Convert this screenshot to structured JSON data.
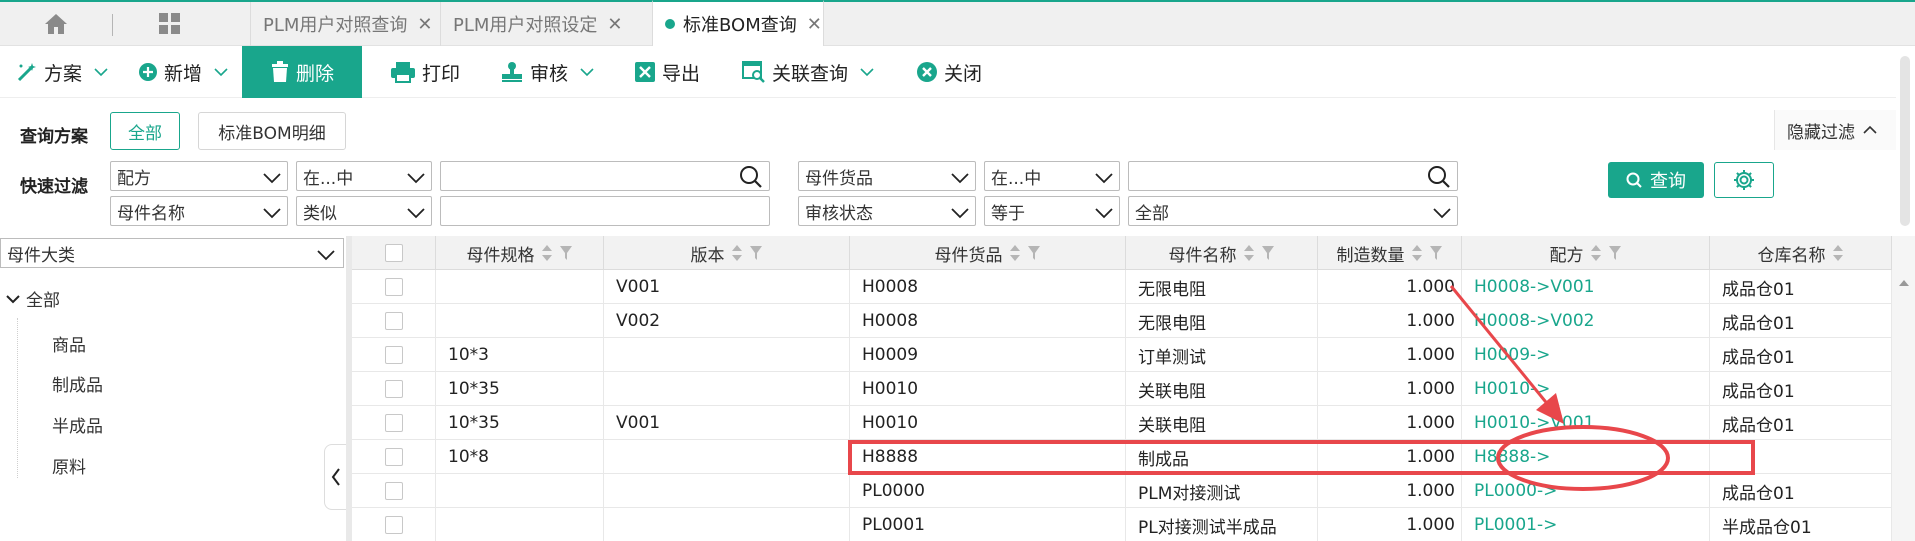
{
  "tabs": [
    {
      "label": "PLM用户对照查询"
    },
    {
      "label": "PLM用户对照设定"
    },
    {
      "label": "标准BOM查询"
    }
  ],
  "toolbar": {
    "scheme": "方案",
    "add": "新增",
    "delete": "删除",
    "print": "打印",
    "audit": "审核",
    "export": "导出",
    "related_query": "关联查询",
    "close": "关闭"
  },
  "filter": {
    "scheme_label": "查询方案",
    "scheme_all": "全部",
    "scheme_detail": "标准BOM明细",
    "hide_filter": "隐藏过滤",
    "quick_label": "快速过滤",
    "row1": {
      "field1": "配方",
      "op1": "在...中",
      "value1": "",
      "field2": "母件货品",
      "op2": "在...中",
      "value2": ""
    },
    "row2": {
      "field1": "母件名称",
      "op1": "类似",
      "value1": "",
      "field2": "审核状态",
      "op2": "等于",
      "value2": "全部"
    },
    "query_button": "查询"
  },
  "tree": {
    "category_select": "母件大类",
    "root": "全部",
    "items": [
      "商品",
      "制成品",
      "半成品",
      "原料"
    ]
  },
  "grid": {
    "columns": [
      "母件规格",
      "版本",
      "母件货品",
      "母件名称",
      "制造数量",
      "配方",
      "仓库名称"
    ],
    "rows": [
      {
        "spec": "",
        "version": "V001",
        "code": "H0008",
        "name": "无限电阻",
        "qty": "1.000",
        "formula": "H0008->V001",
        "warehouse": "成品仓01"
      },
      {
        "spec": "",
        "version": "V002",
        "code": "H0008",
        "name": "无限电阻",
        "qty": "1.000",
        "formula": "H0008->V002",
        "warehouse": "成品仓01"
      },
      {
        "spec": "10*3",
        "version": "",
        "code": "H0009",
        "name": "订单测试",
        "qty": "1.000",
        "formula": "H0009->",
        "warehouse": "成品仓01"
      },
      {
        "spec": "10*35",
        "version": "",
        "code": "H0010",
        "name": "关联电阻",
        "qty": "1.000",
        "formula": "H0010->",
        "warehouse": "成品仓01"
      },
      {
        "spec": "10*35",
        "version": "V001",
        "code": "H0010",
        "name": "关联电阻",
        "qty": "1.000",
        "formula": "H0010->V001",
        "warehouse": "成品仓01"
      },
      {
        "spec": "10*8",
        "version": "",
        "code": "H8888",
        "name": "制成品",
        "qty": "1.000",
        "formula": "H8888->",
        "warehouse": ""
      },
      {
        "spec": "",
        "version": "",
        "code": "PL0000",
        "name": "PLM对接测试",
        "qty": "1.000",
        "formula": "PL0000->",
        "warehouse": "成品仓01"
      },
      {
        "spec": "",
        "version": "",
        "code": "PL0001",
        "name": "PL对接测试半成品",
        "qty": "1.000",
        "formula": "PL0001->",
        "warehouse": "半成品仓01"
      }
    ]
  },
  "colors": {
    "accent": "#19a68c",
    "annotation": "#e8474b"
  }
}
